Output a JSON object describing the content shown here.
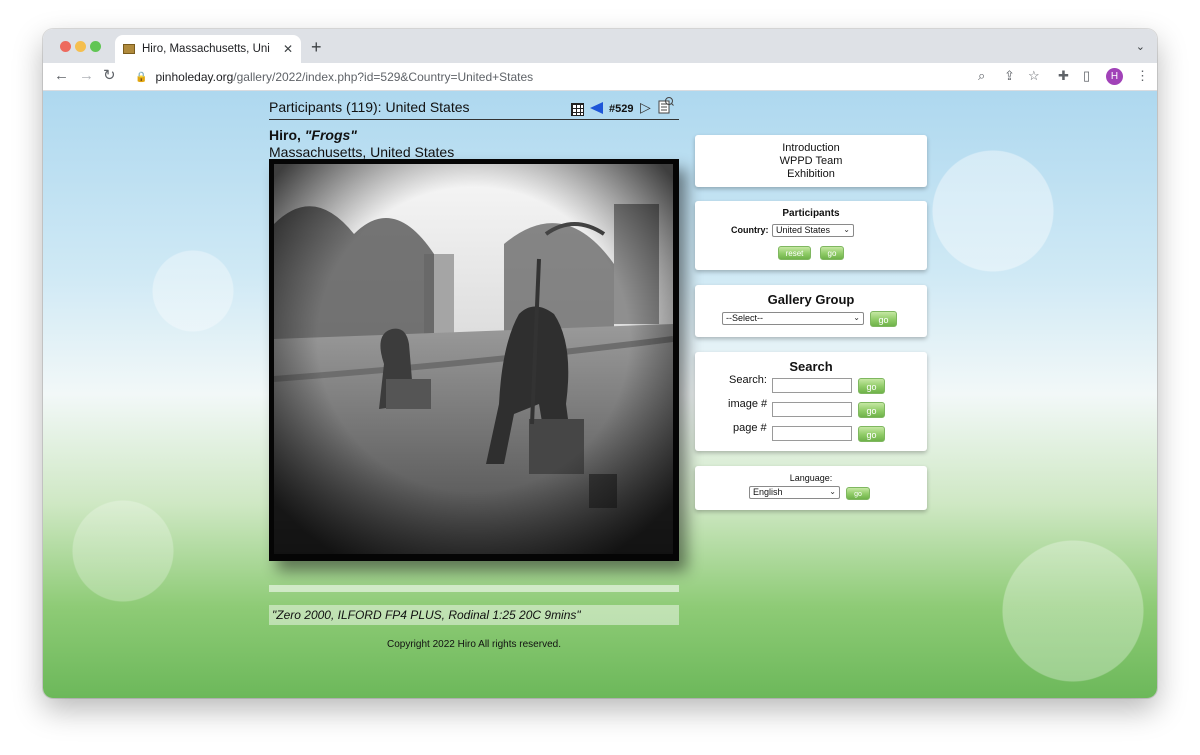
{
  "browser": {
    "tab_title": "Hiro, Massachusetts, United S",
    "tab_close": "✕",
    "new_tab": "+",
    "tab_menu": "⌄",
    "url_host": "pinholeday.org",
    "url_path": "/gallery/2022/index.php?id=529&Country=United+States",
    "profile_initial": "H",
    "back": "←",
    "forward": "→",
    "reload": "↻",
    "lock": "🔒",
    "zoom_icon": "⌕",
    "share_icon": "⇪",
    "star_icon": "☆",
    "extension_icon": "✚",
    "sidebar_icon": "▯",
    "menu_icon": "⋮"
  },
  "gallery": {
    "participants_heading": "Participants (119): United States",
    "image_number": "#529",
    "artist_name": "Hiro, ",
    "photo_title": "\"Frogs\"",
    "location": "Massachusetts, United States",
    "caption": "\"Zero 2000, ILFORD FP4 PLUS, Rodinal 1:25 20C 9mins\"",
    "copyright": "Copyright 2022 Hiro All rights reserved.",
    "next_arrow": "▷"
  },
  "intro_panel": {
    "links": [
      "Introduction",
      "WPPD Team",
      "Exhibition"
    ]
  },
  "participants_panel": {
    "title": "Participants",
    "country_label": "Country:",
    "country_value": "United States",
    "reset_label": "reset",
    "go_label": "go"
  },
  "gallery_group_panel": {
    "title": "Gallery Group",
    "select_value": "--Select--",
    "go_label": "go"
  },
  "search_panel": {
    "title": "Search",
    "search_label": "Search:",
    "image_label": "image #",
    "page_label": "page #",
    "go_label": "go"
  },
  "language_panel": {
    "label": "Language:",
    "value": "English",
    "go_label": "go"
  },
  "colors": {
    "prev_arrow": "#1e56d8",
    "go_button": "#8fcb67",
    "profile": "#a142b8"
  }
}
